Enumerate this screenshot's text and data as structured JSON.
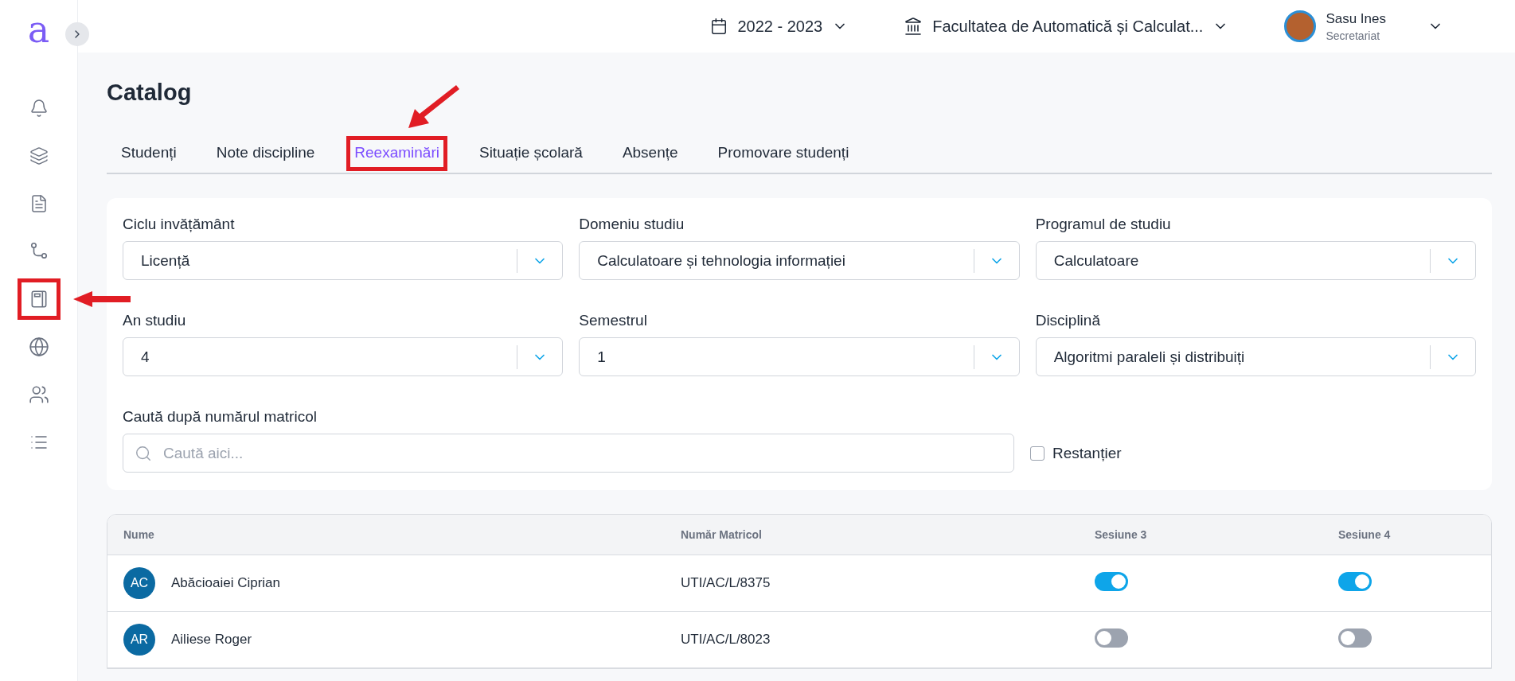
{
  "logo": "a",
  "sidebar": {
    "items": [
      {
        "kind": "bell",
        "annotated": false
      },
      {
        "kind": "layers",
        "annotated": false
      },
      {
        "kind": "document",
        "annotated": false
      },
      {
        "kind": "route",
        "annotated": false
      },
      {
        "kind": "notebook",
        "annotated": true
      },
      {
        "kind": "globe",
        "annotated": false
      },
      {
        "kind": "users",
        "annotated": false
      },
      {
        "kind": "list",
        "annotated": false
      }
    ]
  },
  "topbar": {
    "year": "2022 - 2023",
    "faculty": "Facultatea de Automatică și Calculat...",
    "user": {
      "name": "Sasu Ines",
      "role": "Secretariat"
    }
  },
  "page_title": "Catalog",
  "tabs": [
    {
      "label": "Studenți",
      "selected": false,
      "annotated": false
    },
    {
      "label": "Note discipline",
      "selected": false,
      "annotated": false
    },
    {
      "label": "Reexaminări",
      "selected": true,
      "annotated": true
    },
    {
      "label": "Situație școlară",
      "selected": false,
      "annotated": false
    },
    {
      "label": "Absențe",
      "selected": false,
      "annotated": false
    },
    {
      "label": "Promovare studenți",
      "selected": false,
      "annotated": false
    }
  ],
  "filters": [
    {
      "label": "Ciclu invățământ",
      "value": "Licență"
    },
    {
      "label": "Domeniu studiu",
      "value": "Calculatoare și tehnologia informației"
    },
    {
      "label": "Programul de studiu",
      "value": "Calculatoare"
    },
    {
      "label": "An studiu",
      "value": "4"
    },
    {
      "label": "Semestrul",
      "value": "1"
    },
    {
      "label": "Disciplină",
      "value": "Algoritmi paraleli și distribuiți"
    }
  ],
  "search": {
    "label": "Caută după numărul matricol",
    "placeholder": "Caută aici..."
  },
  "restantier": {
    "label": "Restanțier",
    "checked": false
  },
  "table": {
    "columns": [
      "Nume",
      "Număr Matricol",
      "Sesiune 3",
      "Sesiune 4"
    ],
    "rows": [
      {
        "initials": "AC",
        "name": "Abăcioaiei Ciprian",
        "matricol": "UTI/AC/L/8375",
        "sesiune3": true,
        "sesiune4": true
      },
      {
        "initials": "AR",
        "name": "Ailiese Roger",
        "matricol": "UTI/AC/L/8023",
        "sesiune3": false,
        "sesiune4": false
      }
    ]
  }
}
